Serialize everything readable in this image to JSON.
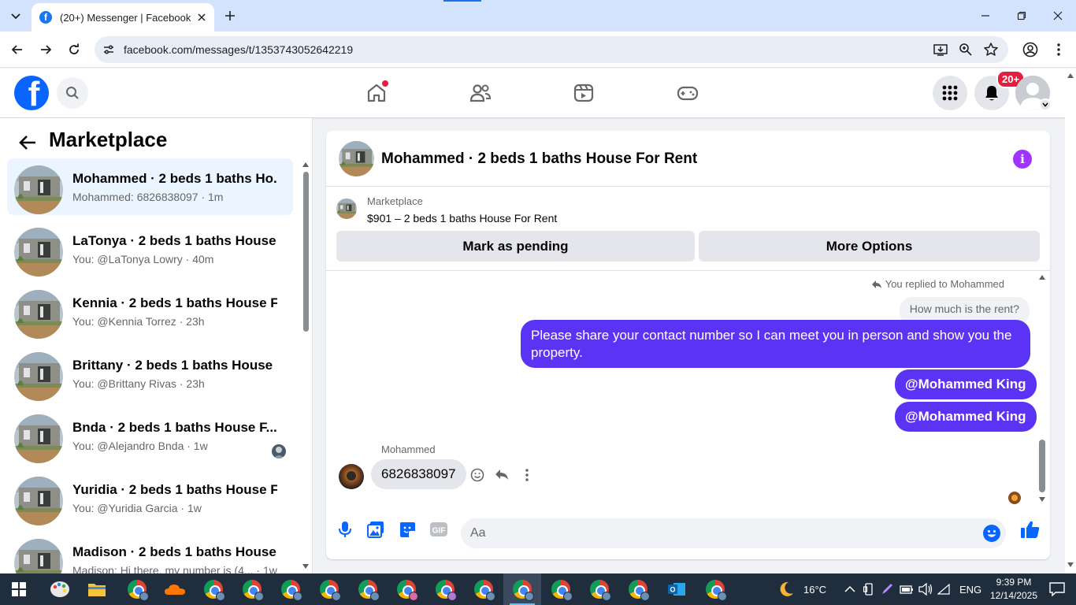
{
  "browser": {
    "tab_title": "(20+) Messenger | Facebook",
    "url": "facebook.com/messages/t/1353743052642219"
  },
  "fb_header": {
    "notification_badge": "20+"
  },
  "sidebar": {
    "title": "Marketplace",
    "conversations": [
      {
        "name": "Mohammed · 2 beds 1 baths Ho...",
        "preview": "Mohammed: 6826838097 · 1m",
        "active": true
      },
      {
        "name": "LaTonya · 2 beds 1 baths House ...",
        "preview": "You: @LaTonya Lowry · 40m"
      },
      {
        "name": "Kennia · 2 beds 1 baths House F...",
        "preview": "You: @Kennia Torrez · 23h"
      },
      {
        "name": "Brittany · 2 beds 1 baths House F...",
        "preview": "You: @Brittany Rivas · 23h"
      },
      {
        "name": "Bnda · 2 beds 1 baths House F...",
        "preview": "You: @Alejandro Bnda · 1w"
      },
      {
        "name": "Yuridia · 2 beds 1 baths House F...",
        "preview": "You: @Yuridia Garcia · 1w"
      },
      {
        "name": "Madison · 2 beds 1 baths House ...",
        "preview": "Madison: Hi there, my number is (4... · 1w"
      }
    ]
  },
  "chat": {
    "title": "Mohammed · 2 beds 1 baths House For Rent",
    "marketplace_label": "Marketplace",
    "listing": "$901 – 2 beds 1 baths House For Rent",
    "mark_pending": "Mark as pending",
    "more_options": "More Options",
    "replied_to": "You replied to Mohammed",
    "quoted_message": "How much is the rent?",
    "outgoing": [
      "Please share your contact number so I can meet you in person and show you the property.",
      "@Mohammed King",
      "@Mohammed King"
    ],
    "incoming_sender": "Mohammed",
    "incoming_message": "6826838097",
    "composer_placeholder": "Aa"
  },
  "taskbar": {
    "weather": "16°C",
    "language": "ENG",
    "time": "9:39 PM",
    "date": "12/14/2025"
  },
  "colors": {
    "outgoing_bubble": "#5b33f5",
    "facebook_blue": "#0866ff",
    "info_purple": "#a033ff"
  }
}
